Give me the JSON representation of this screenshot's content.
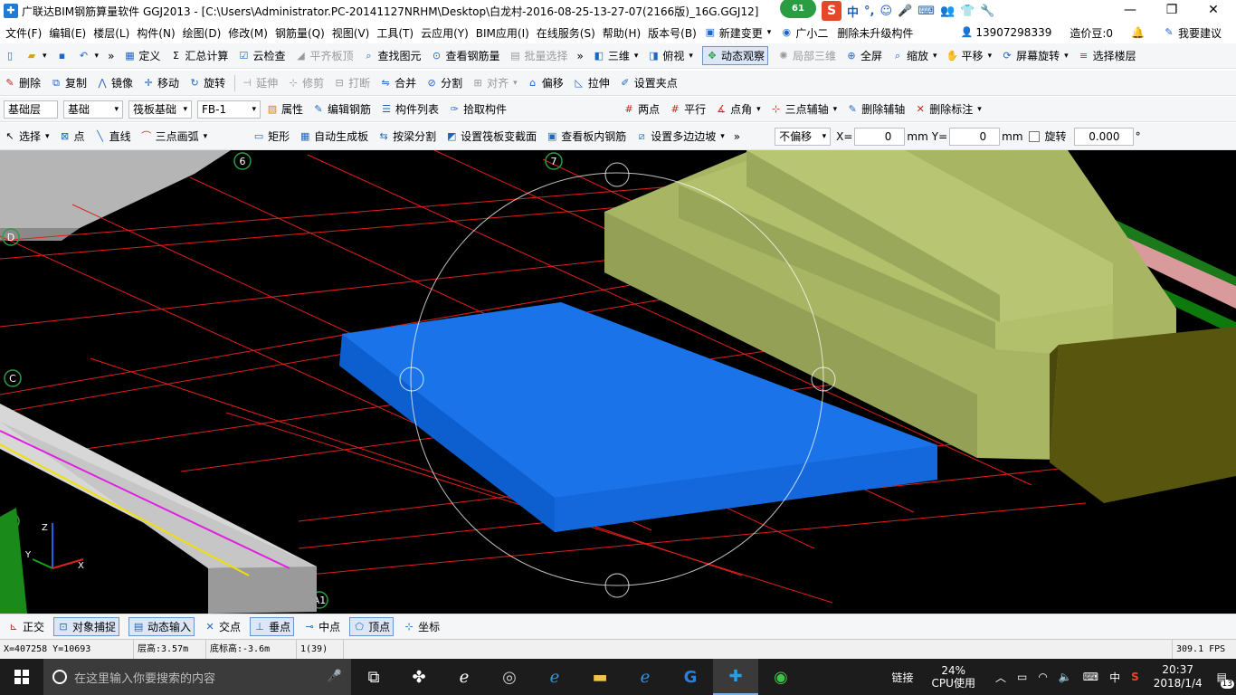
{
  "window": {
    "title": "广联达BIM钢筋算量软件 GGJ2013 - [C:\\Users\\Administrator.PC-20141127NRHM\\Desktop\\白龙村-2016-08-25-13-27-07(2166版)_16G.GGJ12]",
    "minimize": "—",
    "restore": "❐",
    "close": "✕"
  },
  "ime": {
    "badge": "61",
    "logo": "S",
    "lang": "中",
    "items": [
      "°,",
      "☺",
      "🎤",
      "⌨",
      "👥",
      "👕",
      "🔧"
    ]
  },
  "menu": {
    "items": [
      "文件(F)",
      "编辑(E)",
      "楼层(L)",
      "构件(N)",
      "绘图(D)",
      "修改(M)",
      "钢筋量(Q)",
      "视图(V)",
      "工具(T)",
      "云应用(Y)",
      "BIM应用(I)",
      "在线服务(S)",
      "帮助(H)",
      "版本号(B)"
    ],
    "new_change": "新建变更",
    "guangxiaoer": "广小二",
    "delete_unused": "删除未升级构件",
    "phone": "13907298339",
    "cost_beans": "造价豆:0",
    "feedback": "我要建议"
  },
  "toolbar1": {
    "define": "定义",
    "summary": "汇总计算",
    "cloud_check": "云检查",
    "flat_top": "平齐板顶",
    "find": "查找图元",
    "view_rebar": "查看钢筋量",
    "batch_select": "批量选择",
    "view3d": "三维",
    "top_view": "俯视",
    "dynamic_view": "动态观察",
    "local3d": "局部三维",
    "fullscreen": "全屏",
    "zoom": "缩放",
    "pan": "平移",
    "rotate_screen": "屏幕旋转",
    "select_floor": "选择楼层"
  },
  "toolbar2": {
    "delete": "删除",
    "copy": "复制",
    "mirror": "镜像",
    "move": "移动",
    "rotate": "旋转",
    "extend": "延伸",
    "trim": "修剪",
    "break": "打断",
    "merge": "合并",
    "split": "分割",
    "align": "对齐",
    "offset": "偏移",
    "stretch": "拉伸",
    "grip": "设置夹点"
  },
  "toolbar3": {
    "floor": "基础层",
    "category": "基础",
    "type": "筏板基础",
    "component": "FB-1",
    "attributes": "属性",
    "edit_rebar": "编辑钢筋",
    "component_list": "构件列表",
    "pick": "拾取构件",
    "two_points": "两点",
    "parallel": "平行",
    "point_angle": "点角",
    "three_point_axis": "三点辅轴",
    "delete_axis": "删除辅轴",
    "delete_mark": "删除标注"
  },
  "toolbar4": {
    "select": "选择",
    "point": "点",
    "line": "直线",
    "arc": "三点画弧",
    "rect": "矩形",
    "auto_slab": "自动生成板",
    "split_by_beam": "按梁分割",
    "set_section": "设置筏板变截面",
    "view_inner_rebar": "查看板内钢筋",
    "set_slope": "设置多边边坡",
    "offset_mode": "不偏移",
    "x_label": "X=",
    "x_value": "0",
    "y_label": "Y=",
    "y_value": "0",
    "unit": "mm",
    "rotate_label": "旋转",
    "rotate_value": "0.000",
    "degree": "°"
  },
  "viewport": {
    "axis_labels": [
      "6",
      "7",
      "D",
      "C",
      "A1",
      "A"
    ],
    "colors": {
      "background": "#000000",
      "grid": "#e0201c",
      "slab": "#1a73e8",
      "slab_side": "#0d5fd0",
      "footing_top": "#a8b664",
      "footing_side": "#93a055",
      "column": "#57550e",
      "beam": "#d7d7d7"
    }
  },
  "snapbar": {
    "ortho": "正交",
    "object_snap": "对象捕捉",
    "dynamic_input": "动态输入",
    "intersection": "交点",
    "perpendicular": "垂点",
    "midpoint": "中点",
    "vertex": "顶点",
    "coordinate": "坐标"
  },
  "status": {
    "coords": "X=407258 Y=10693",
    "floor_height": "层高:3.57m",
    "base_elevation": "底标高:-3.6m",
    "count": "1(39)",
    "fps": "309.1 FPS"
  },
  "taskbar": {
    "search_placeholder": "在这里输入你要搜索的内容",
    "link": "链接",
    "cpu_percent": "24%",
    "cpu_label": "CPU使用",
    "ime": "中",
    "time": "20:37",
    "date": "2018/1/4",
    "notifications": "13"
  }
}
